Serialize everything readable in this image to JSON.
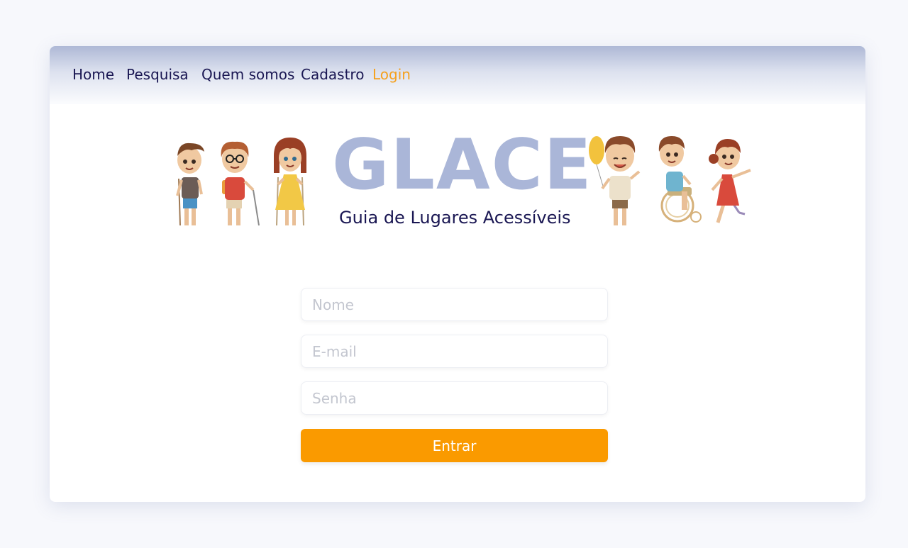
{
  "nav": {
    "items": [
      {
        "label": "Home"
      },
      {
        "label": "Pesquisa"
      },
      {
        "label": "Quem somos"
      },
      {
        "label": "Cadastro"
      },
      {
        "label": "Login",
        "active": true
      }
    ]
  },
  "banner": {
    "title": "GLACE",
    "subtitle": "Guia de Lugares Acessíveis"
  },
  "login_form": {
    "name_placeholder": "Nome",
    "email_placeholder": "E-mail",
    "password_placeholder": "Senha",
    "submit_label": "Entrar"
  },
  "colors": {
    "accent": "#fa9a00",
    "nav_active": "#f5a01d",
    "nav_text": "#1a1753",
    "title": "#aab6d8"
  },
  "icons": [
    "kid-with-crutch-illustration",
    "kid-with-cane-illustration",
    "girl-with-crutches-illustration",
    "kid-with-balloon-illustration",
    "kid-in-wheelchair-illustration",
    "girl-with-prosthetic-leg-illustration"
  ]
}
